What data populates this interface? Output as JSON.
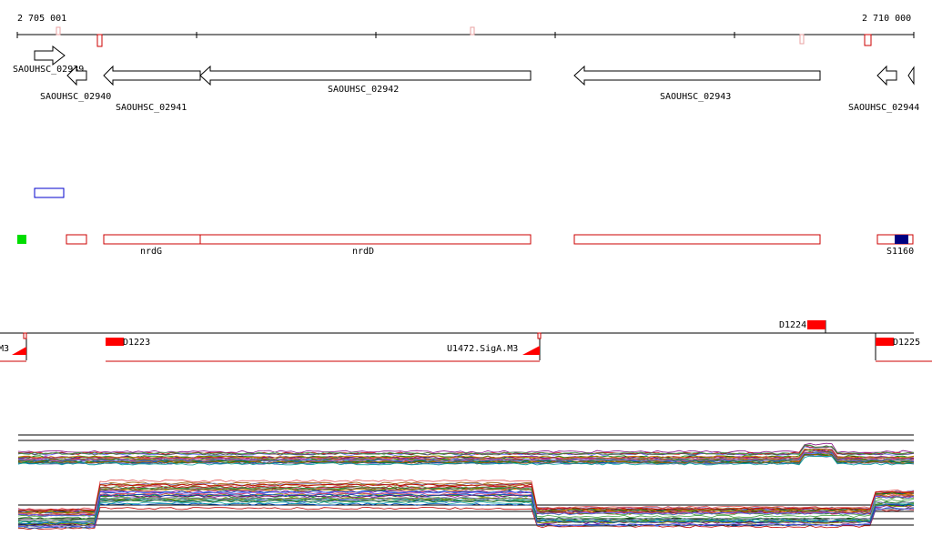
{
  "coordinates": {
    "start": "2 705 001",
    "end": "2 710 000"
  },
  "genes": [
    {
      "id": "SAOUHSC_02939",
      "strand": "+"
    },
    {
      "id": "SAOUHSC_02940",
      "strand": "-"
    },
    {
      "id": "SAOUHSC_02941",
      "strand": "-"
    },
    {
      "id": "SAOUHSC_02942",
      "strand": "-"
    },
    {
      "id": "SAOUHSC_02943",
      "strand": "-"
    },
    {
      "id": "SAOUHSC_02944",
      "strand": "-"
    }
  ],
  "features": [
    {
      "label": "nrdG"
    },
    {
      "label": "nrdD"
    },
    {
      "label": "S1160"
    }
  ],
  "segments": [
    {
      "label": "M3"
    },
    {
      "label": "D1223"
    },
    {
      "label": "U1472.SigA.M3"
    },
    {
      "label": "D1224"
    },
    {
      "label": "D1225"
    }
  ],
  "colors": {
    "axis": "#000000",
    "feature_outline": "#cc0000",
    "segment_fill": "#ff0000",
    "blue_box": "#0000cc",
    "green_marker": "#00dd00",
    "dark_blue_marker": "#000080"
  },
  "expression_tracks": {
    "track_1": "upper expression profiles",
    "track_2": "lower expression profiles"
  }
}
